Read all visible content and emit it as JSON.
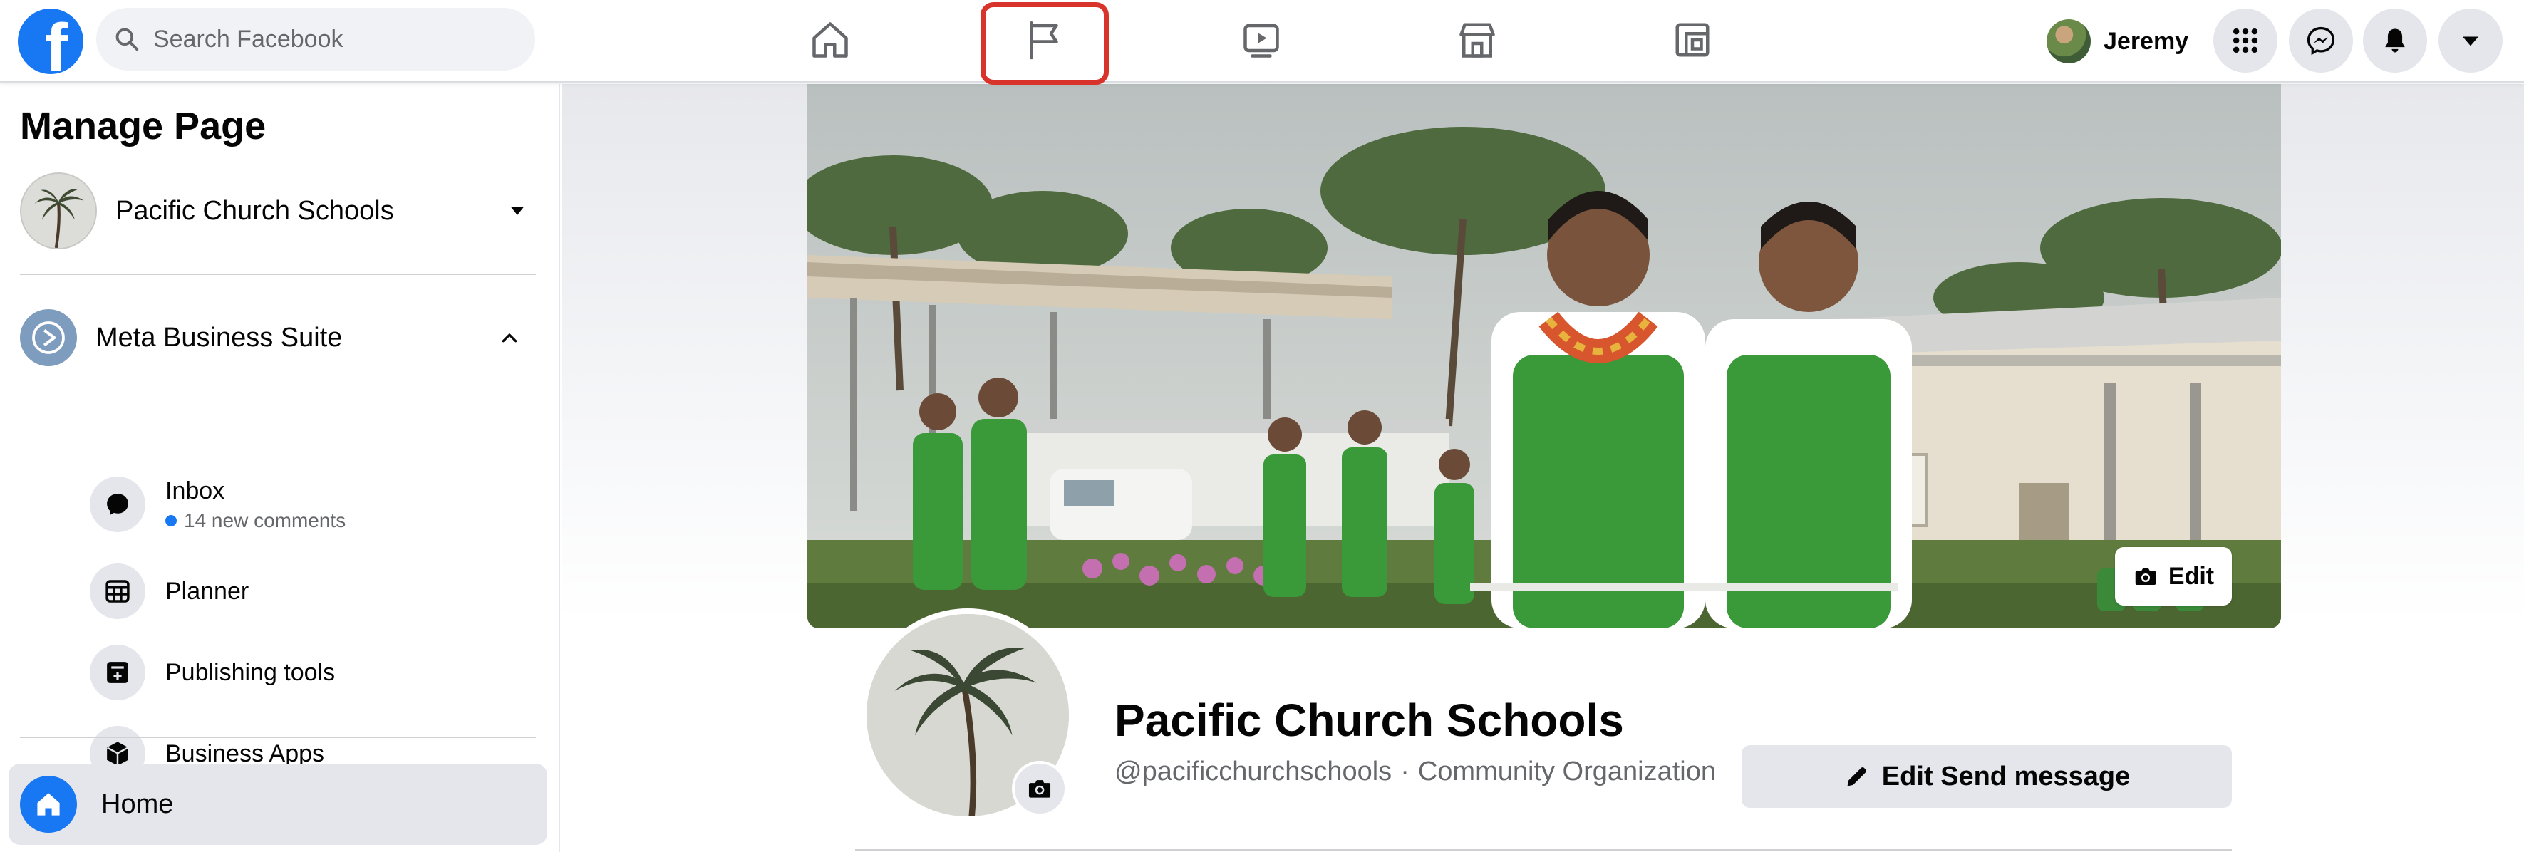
{
  "topbar": {
    "logo_letter": "f",
    "search_placeholder": "Search Facebook",
    "tabs": [
      {
        "icon": "home-icon"
      },
      {
        "icon": "flag-pages-icon",
        "highlighted": true
      },
      {
        "icon": "watch-video-icon"
      },
      {
        "icon": "marketplace-store-icon"
      },
      {
        "icon": "gaming-icon"
      }
    ],
    "highlight_color": "#d9342b",
    "profile_name": "Jeremy",
    "right_buttons": [
      "menu-grid-icon",
      "messenger-icon",
      "notifications-bell-icon",
      "account-caret-icon"
    ]
  },
  "sidebar": {
    "title": "Manage Page",
    "page_name": "Pacific Church Schools",
    "suite_label": "Meta Business Suite",
    "items": [
      {
        "label": "Inbox",
        "meta": "14 new comments",
        "icon": "inbox-chat-icon"
      },
      {
        "label": "Planner",
        "icon": "planner-calendar-icon"
      },
      {
        "label": "Publishing tools",
        "icon": "publishing-tools-icon"
      },
      {
        "label": "Business Apps",
        "icon": "business-apps-cube-icon"
      }
    ],
    "home_label": "Home"
  },
  "main": {
    "cover_edit_label": "Edit",
    "page_title": "Pacific Church Schools",
    "handle": "@pacificchurchschools",
    "separator": "·",
    "category": "Community Organization",
    "primary_button_label": "Edit Send message"
  },
  "colors": {
    "brand_blue": "#1877f2",
    "button_gray": "#e4e6eb",
    "secondary_text": "#65676b",
    "uniform_green": "#3a9a3a"
  }
}
